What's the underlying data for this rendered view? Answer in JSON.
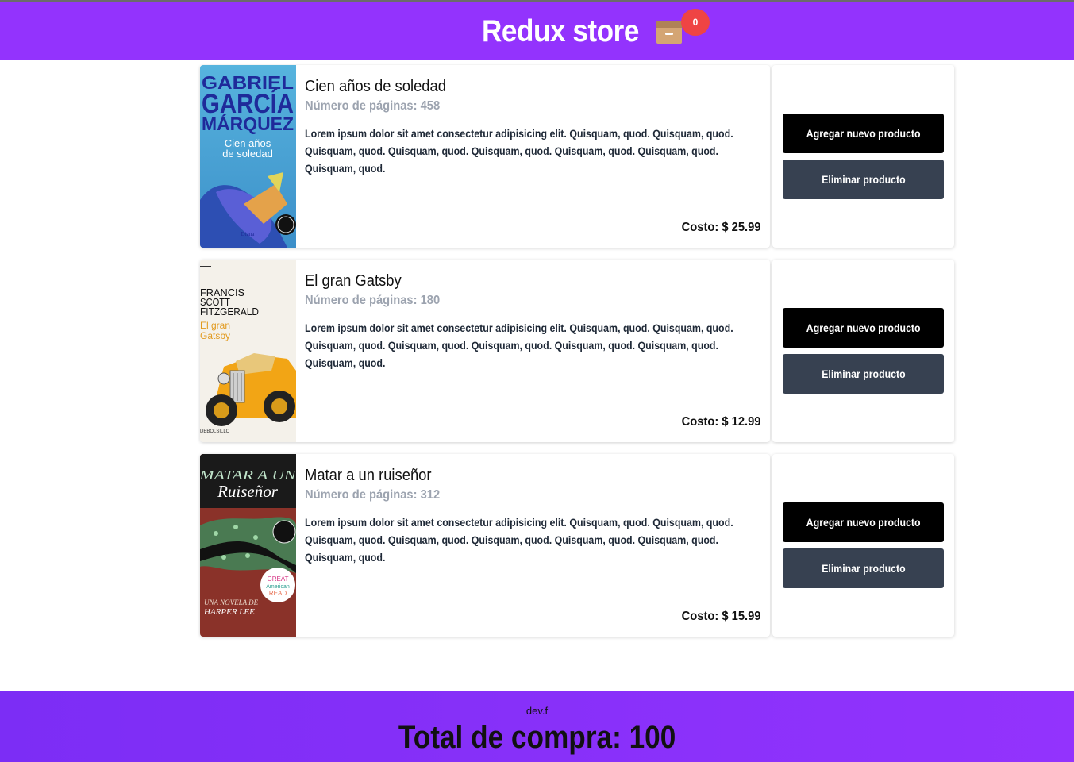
{
  "header": {
    "title": "Redux store",
    "cart_icon": "box-icon",
    "cart_count": "0"
  },
  "products": [
    {
      "title": "Cien años de soledad",
      "pages": "Número de páginas: 458",
      "description": "Lorem ipsum dolor sit amet consectetur adipisicing elit. Quisquam, quod. Quisquam, quod. Quisquam, quod. Quisquam, quod. Quisquam, quod. Quisquam, quod. Quisquam, quod. Quisquam, quod.",
      "cost": "Costo: $ 25.99",
      "cover_author": "GABRIEL GARCÍA MÁRQUEZ",
      "cover_title": "Cien años de soledad",
      "add_label": "Agregar nuevo producto",
      "remove_label": "Eliminar producto"
    },
    {
      "title": "El gran Gatsby",
      "pages": "Número de páginas: 180",
      "description": "Lorem ipsum dolor sit amet consectetur adipisicing elit. Quisquam, quod. Quisquam, quod. Quisquam, quod. Quisquam, quod. Quisquam, quod. Quisquam, quod. Quisquam, quod. Quisquam, quod.",
      "cost": "Costo: $ 12.99",
      "cover_author": "FRANCIS SCOTT FITZGERALD",
      "cover_title": "El gran Gatsby",
      "add_label": "Agregar nuevo producto",
      "remove_label": "Eliminar producto"
    },
    {
      "title": "Matar a un ruiseñor",
      "pages": "Número de páginas: 312",
      "description": "Lorem ipsum dolor sit amet consectetur adipisicing elit. Quisquam, quod. Quisquam, quod. Quisquam, quod. Quisquam, quod. Quisquam, quod. Quisquam, quod. Quisquam, quod. Quisquam, quod.",
      "cost": "Costo: $ 15.99",
      "cover_author": "HARPER LEE",
      "cover_title": "MATAR A UN Ruiseñor",
      "cover_sub": "UNA NOVELA DE",
      "add_label": "Agregar nuevo producto",
      "remove_label": "Eliminar producto"
    }
  ],
  "footer": {
    "brand": "dev.f",
    "total": "Total de compra: 100"
  },
  "colors": {
    "header_bg": "#9333fd",
    "badge": "#ef4444",
    "add_button": "#000000",
    "remove_button": "#374151"
  }
}
